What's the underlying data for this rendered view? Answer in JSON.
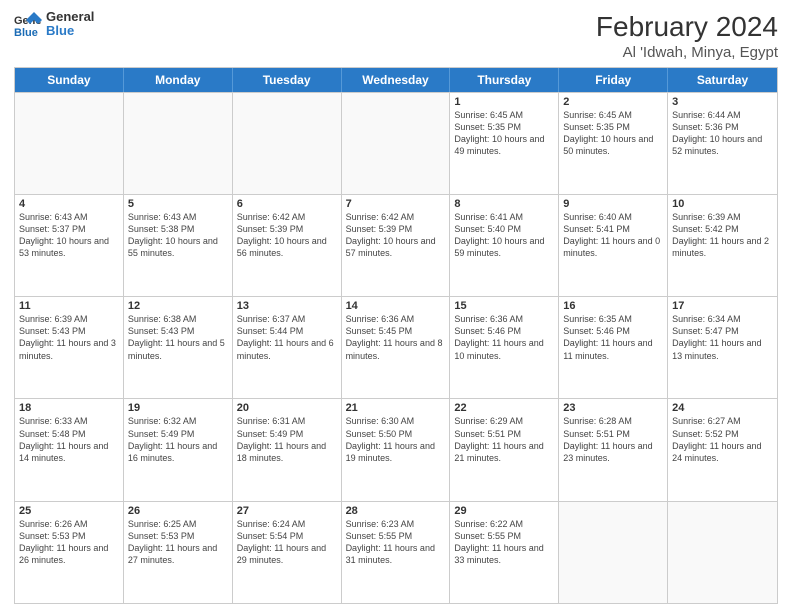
{
  "header": {
    "logo_line1": "General",
    "logo_line2": "Blue",
    "title": "February 2024",
    "subtitle": "Al 'Idwah, Minya, Egypt"
  },
  "days_of_week": [
    "Sunday",
    "Monday",
    "Tuesday",
    "Wednesday",
    "Thursday",
    "Friday",
    "Saturday"
  ],
  "weeks": [
    [
      {
        "day": "",
        "sunrise": "",
        "sunset": "",
        "daylight": ""
      },
      {
        "day": "",
        "sunrise": "",
        "sunset": "",
        "daylight": ""
      },
      {
        "day": "",
        "sunrise": "",
        "sunset": "",
        "daylight": ""
      },
      {
        "day": "",
        "sunrise": "",
        "sunset": "",
        "daylight": ""
      },
      {
        "day": "1",
        "sunrise": "Sunrise: 6:45 AM",
        "sunset": "Sunset: 5:35 PM",
        "daylight": "Daylight: 10 hours and 49 minutes."
      },
      {
        "day": "2",
        "sunrise": "Sunrise: 6:45 AM",
        "sunset": "Sunset: 5:35 PM",
        "daylight": "Daylight: 10 hours and 50 minutes."
      },
      {
        "day": "3",
        "sunrise": "Sunrise: 6:44 AM",
        "sunset": "Sunset: 5:36 PM",
        "daylight": "Daylight: 10 hours and 52 minutes."
      }
    ],
    [
      {
        "day": "4",
        "sunrise": "Sunrise: 6:43 AM",
        "sunset": "Sunset: 5:37 PM",
        "daylight": "Daylight: 10 hours and 53 minutes."
      },
      {
        "day": "5",
        "sunrise": "Sunrise: 6:43 AM",
        "sunset": "Sunset: 5:38 PM",
        "daylight": "Daylight: 10 hours and 55 minutes."
      },
      {
        "day": "6",
        "sunrise": "Sunrise: 6:42 AM",
        "sunset": "Sunset: 5:39 PM",
        "daylight": "Daylight: 10 hours and 56 minutes."
      },
      {
        "day": "7",
        "sunrise": "Sunrise: 6:42 AM",
        "sunset": "Sunset: 5:39 PM",
        "daylight": "Daylight: 10 hours and 57 minutes."
      },
      {
        "day": "8",
        "sunrise": "Sunrise: 6:41 AM",
        "sunset": "Sunset: 5:40 PM",
        "daylight": "Daylight: 10 hours and 59 minutes."
      },
      {
        "day": "9",
        "sunrise": "Sunrise: 6:40 AM",
        "sunset": "Sunset: 5:41 PM",
        "daylight": "Daylight: 11 hours and 0 minutes."
      },
      {
        "day": "10",
        "sunrise": "Sunrise: 6:39 AM",
        "sunset": "Sunset: 5:42 PM",
        "daylight": "Daylight: 11 hours and 2 minutes."
      }
    ],
    [
      {
        "day": "11",
        "sunrise": "Sunrise: 6:39 AM",
        "sunset": "Sunset: 5:43 PM",
        "daylight": "Daylight: 11 hours and 3 minutes."
      },
      {
        "day": "12",
        "sunrise": "Sunrise: 6:38 AM",
        "sunset": "Sunset: 5:43 PM",
        "daylight": "Daylight: 11 hours and 5 minutes."
      },
      {
        "day": "13",
        "sunrise": "Sunrise: 6:37 AM",
        "sunset": "Sunset: 5:44 PM",
        "daylight": "Daylight: 11 hours and 6 minutes."
      },
      {
        "day": "14",
        "sunrise": "Sunrise: 6:36 AM",
        "sunset": "Sunset: 5:45 PM",
        "daylight": "Daylight: 11 hours and 8 minutes."
      },
      {
        "day": "15",
        "sunrise": "Sunrise: 6:36 AM",
        "sunset": "Sunset: 5:46 PM",
        "daylight": "Daylight: 11 hours and 10 minutes."
      },
      {
        "day": "16",
        "sunrise": "Sunrise: 6:35 AM",
        "sunset": "Sunset: 5:46 PM",
        "daylight": "Daylight: 11 hours and 11 minutes."
      },
      {
        "day": "17",
        "sunrise": "Sunrise: 6:34 AM",
        "sunset": "Sunset: 5:47 PM",
        "daylight": "Daylight: 11 hours and 13 minutes."
      }
    ],
    [
      {
        "day": "18",
        "sunrise": "Sunrise: 6:33 AM",
        "sunset": "Sunset: 5:48 PM",
        "daylight": "Daylight: 11 hours and 14 minutes."
      },
      {
        "day": "19",
        "sunrise": "Sunrise: 6:32 AM",
        "sunset": "Sunset: 5:49 PM",
        "daylight": "Daylight: 11 hours and 16 minutes."
      },
      {
        "day": "20",
        "sunrise": "Sunrise: 6:31 AM",
        "sunset": "Sunset: 5:49 PM",
        "daylight": "Daylight: 11 hours and 18 minutes."
      },
      {
        "day": "21",
        "sunrise": "Sunrise: 6:30 AM",
        "sunset": "Sunset: 5:50 PM",
        "daylight": "Daylight: 11 hours and 19 minutes."
      },
      {
        "day": "22",
        "sunrise": "Sunrise: 6:29 AM",
        "sunset": "Sunset: 5:51 PM",
        "daylight": "Daylight: 11 hours and 21 minutes."
      },
      {
        "day": "23",
        "sunrise": "Sunrise: 6:28 AM",
        "sunset": "Sunset: 5:51 PM",
        "daylight": "Daylight: 11 hours and 23 minutes."
      },
      {
        "day": "24",
        "sunrise": "Sunrise: 6:27 AM",
        "sunset": "Sunset: 5:52 PM",
        "daylight": "Daylight: 11 hours and 24 minutes."
      }
    ],
    [
      {
        "day": "25",
        "sunrise": "Sunrise: 6:26 AM",
        "sunset": "Sunset: 5:53 PM",
        "daylight": "Daylight: 11 hours and 26 minutes."
      },
      {
        "day": "26",
        "sunrise": "Sunrise: 6:25 AM",
        "sunset": "Sunset: 5:53 PM",
        "daylight": "Daylight: 11 hours and 27 minutes."
      },
      {
        "day": "27",
        "sunrise": "Sunrise: 6:24 AM",
        "sunset": "Sunset: 5:54 PM",
        "daylight": "Daylight: 11 hours and 29 minutes."
      },
      {
        "day": "28",
        "sunrise": "Sunrise: 6:23 AM",
        "sunset": "Sunset: 5:55 PM",
        "daylight": "Daylight: 11 hours and 31 minutes."
      },
      {
        "day": "29",
        "sunrise": "Sunrise: 6:22 AM",
        "sunset": "Sunset: 5:55 PM",
        "daylight": "Daylight: 11 hours and 33 minutes."
      },
      {
        "day": "",
        "sunrise": "",
        "sunset": "",
        "daylight": ""
      },
      {
        "day": "",
        "sunrise": "",
        "sunset": "",
        "daylight": ""
      }
    ]
  ]
}
